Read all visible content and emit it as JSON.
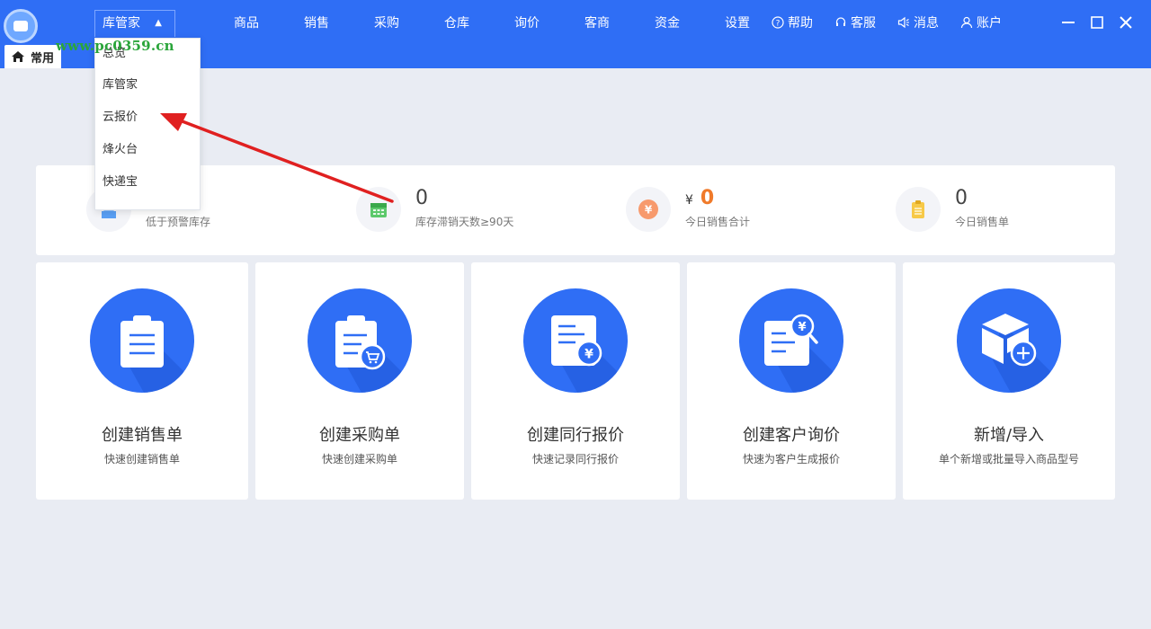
{
  "header": {
    "module_select": "库管家",
    "watermark": "www.pc0359.cn",
    "nav": [
      "商品",
      "销售",
      "采购",
      "仓库",
      "询价",
      "客商",
      "资金",
      "设置"
    ],
    "utils": [
      {
        "label": "帮助",
        "icon": "help-icon"
      },
      {
        "label": "客服",
        "icon": "headset-icon"
      },
      {
        "label": "消息",
        "icon": "speaker-icon"
      },
      {
        "label": "账户",
        "icon": "user-icon"
      }
    ],
    "tab": "常用"
  },
  "dropdown": {
    "items": [
      "总览",
      "库管家",
      "云报价",
      "烽火台",
      "快递宝"
    ]
  },
  "stats": [
    {
      "value": "",
      "label": "低于预警库存",
      "icon": "stock-warning-icon"
    },
    {
      "value": "0",
      "label": "库存滞销天数≥90天",
      "icon": "calendar-icon"
    },
    {
      "currency": "¥",
      "value": "0",
      "label": "今日销售合计",
      "icon": "yen-icon"
    },
    {
      "value": "0",
      "label": "今日销售单",
      "icon": "clipboard-icon"
    }
  ],
  "cards": [
    {
      "title": "创建销售单",
      "subtitle": "快速创建销售单",
      "icon": "clipboard-list-icon"
    },
    {
      "title": "创建采购单",
      "subtitle": "快速创建采购单",
      "icon": "clipboard-cart-icon"
    },
    {
      "title": "创建同行报价",
      "subtitle": "快速记录同行报价",
      "icon": "document-yen-icon"
    },
    {
      "title": "创建客户询价",
      "subtitle": "快速为客户生成报价",
      "icon": "document-search-yen-icon"
    },
    {
      "title": "新增/导入",
      "subtitle": "单个新增或批量导入商品型号",
      "icon": "box-add-icon"
    }
  ],
  "colors": {
    "primary": "#2f6ef5",
    "background": "#e9ecf3",
    "accent_orange": "#f07a2a",
    "annotation_red": "#e02020"
  }
}
